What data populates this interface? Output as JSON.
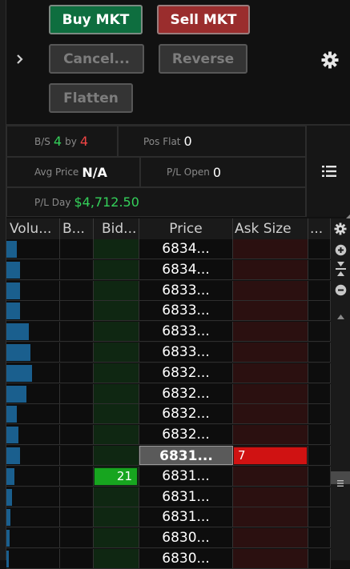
{
  "toolbar": {
    "buy_label": "Buy MKT",
    "sell_label": "Sell MKT",
    "cancel_label": "Cancel...",
    "reverse_label": "Reverse",
    "flatten_label": "Flatten"
  },
  "position": {
    "bs_label": "B/S",
    "bs_buy": "4",
    "bs_by": "by",
    "bs_sell": "4",
    "pos_label": "Pos Flat",
    "pos_value": "0",
    "avg_label": "Avg Price",
    "avg_value": "N/A",
    "plopen_label": "P/L Open",
    "plopen_value": "0",
    "plday_label": "P/L Day",
    "plday_value": "$4,712.50"
  },
  "ladder": {
    "headers": [
      "Volu...",
      "B...",
      "Bid...",
      "Price",
      "Ask Size",
      "..."
    ],
    "rows": [
      {
        "price": "6834...",
        "volume_fraction": 0.2,
        "bid": "",
        "ask": ""
      },
      {
        "price": "6834...",
        "volume_fraction": 0.25,
        "bid": "",
        "ask": ""
      },
      {
        "price": "6833...",
        "volume_fraction": 0.25,
        "bid": "",
        "ask": ""
      },
      {
        "price": "6833...",
        "volume_fraction": 0.25,
        "bid": "",
        "ask": ""
      },
      {
        "price": "6833...",
        "volume_fraction": 0.42,
        "bid": "",
        "ask": ""
      },
      {
        "price": "6833...",
        "volume_fraction": 0.45,
        "bid": "",
        "ask": ""
      },
      {
        "price": "6832...",
        "volume_fraction": 0.48,
        "bid": "",
        "ask": ""
      },
      {
        "price": "6832...",
        "volume_fraction": 0.37,
        "bid": "",
        "ask": ""
      },
      {
        "price": "6832...",
        "volume_fraction": 0.2,
        "bid": "",
        "ask": ""
      },
      {
        "price": "6832...",
        "volume_fraction": 0.22,
        "bid": "",
        "ask": ""
      },
      {
        "price": "6831...",
        "volume_fraction": 0.25,
        "bid": "",
        "ask": "7",
        "current": true
      },
      {
        "price": "6831...",
        "volume_fraction": 0.15,
        "bid": "21",
        "ask": ""
      },
      {
        "price": "6831...",
        "volume_fraction": 0.1,
        "bid": "",
        "ask": ""
      },
      {
        "price": "6831...",
        "volume_fraction": 0.08,
        "bid": "",
        "ask": ""
      },
      {
        "price": "6830...",
        "volume_fraction": 0.06,
        "bid": "",
        "ask": ""
      },
      {
        "price": "6830...",
        "volume_fraction": 0.05,
        "bid": "",
        "ask": ""
      }
    ]
  },
  "colors": {
    "buy": "#0e6e3f",
    "sell": "#9a2d2d",
    "bid_highlight": "#17a51f",
    "ask_highlight": "#d01212",
    "volume_bar": "#1a5f8e"
  },
  "icons": [
    "chevron-right-icon",
    "gear-icon",
    "list-icon",
    "zoom-in-icon",
    "center-icon",
    "zoom-out-icon",
    "scroll-up-icon",
    "handle-icon"
  ]
}
